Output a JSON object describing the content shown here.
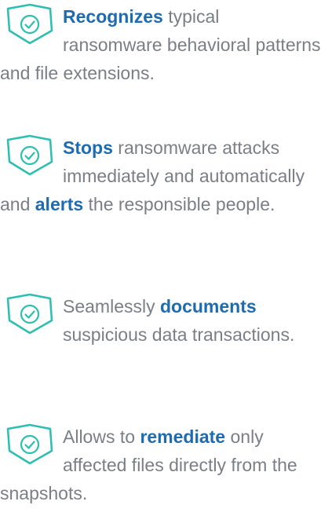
{
  "features": [
    {
      "icon": "check-badge-icon",
      "parts": [
        {
          "text": "Recognizes",
          "highlight": true
        },
        {
          "text": " typical ransomware behavioral patterns and file extensions.",
          "highlight": false
        }
      ]
    },
    {
      "icon": "check-badge-icon",
      "parts": [
        {
          "text": "Stops",
          "highlight": true
        },
        {
          "text": " ransomware attacks immediately and automatically and ",
          "highlight": false
        },
        {
          "text": "alerts",
          "highlight": true
        },
        {
          "text": " the responsible people.",
          "highlight": false
        }
      ]
    },
    {
      "icon": "check-badge-icon",
      "parts": [
        {
          "text": "Seamlessly ",
          "highlight": false
        },
        {
          "text": "documents",
          "highlight": true
        },
        {
          "text": " suspicious data transactions.",
          "highlight": false
        }
      ]
    },
    {
      "icon": "check-badge-icon",
      "parts": [
        {
          "text": "Allows to ",
          "highlight": false
        },
        {
          "text": "remediate",
          "highlight": true
        },
        {
          "text": " only affected files directly from the snapshots.",
          "highlight": false
        }
      ]
    }
  ],
  "colors": {
    "text": "#7a7f86",
    "highlight": "#1f6bb0",
    "icon": "#2cbfb0"
  }
}
